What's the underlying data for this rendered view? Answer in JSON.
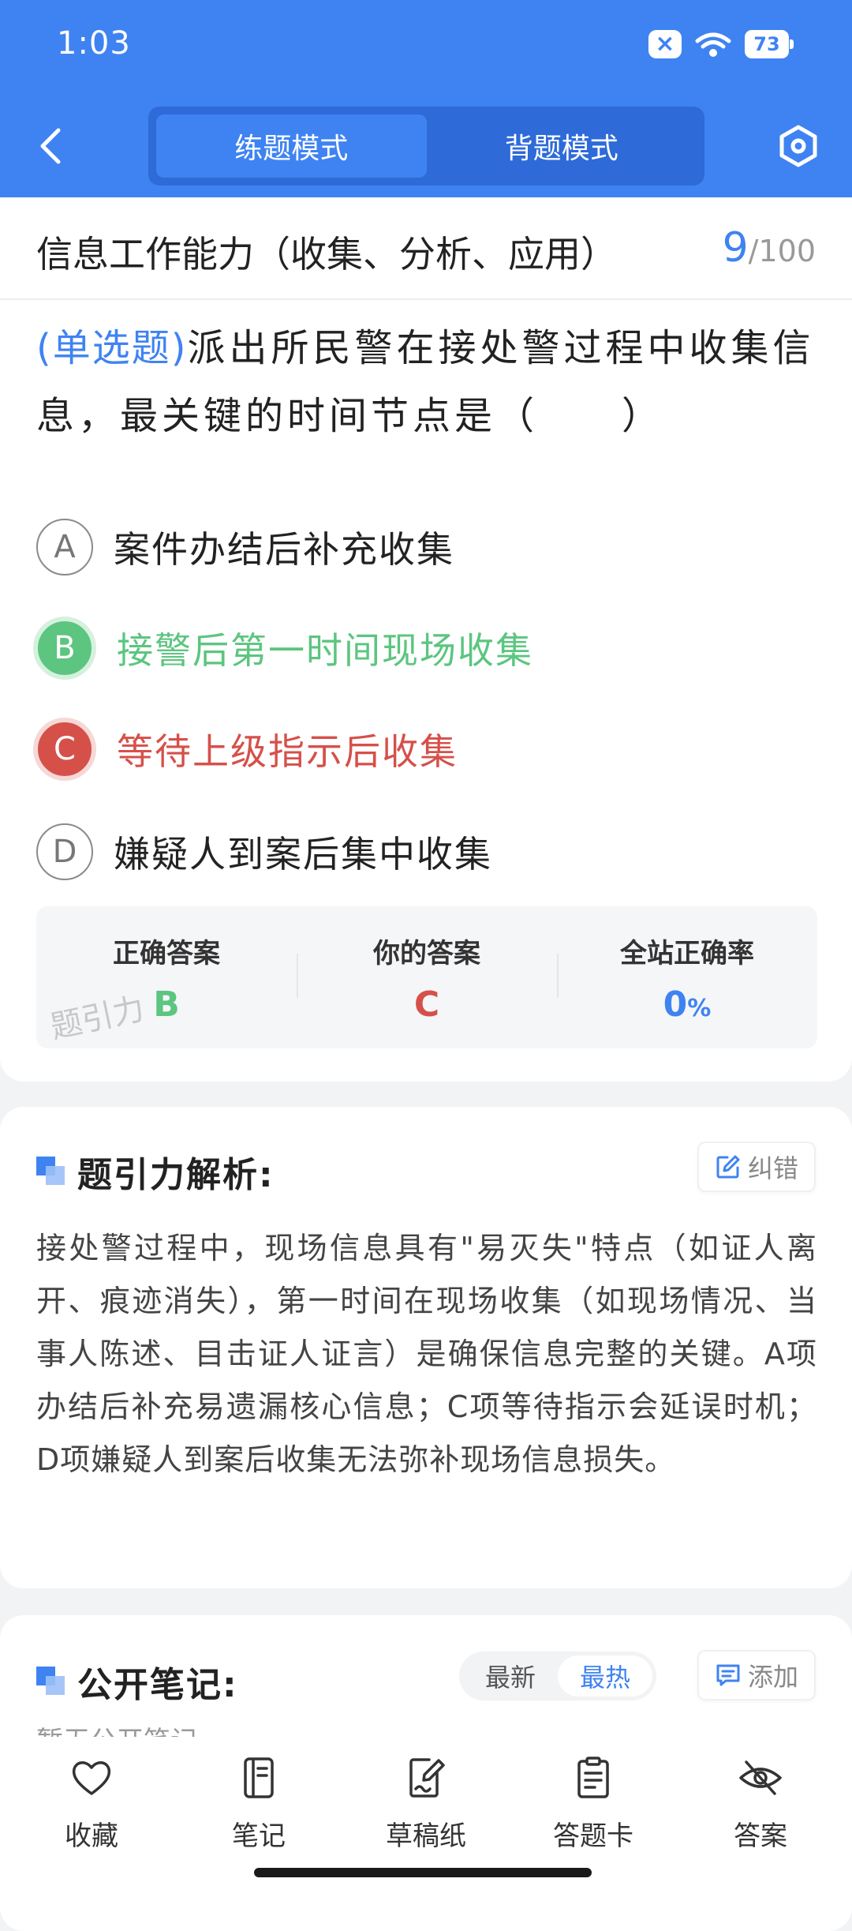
{
  "status_bar": {
    "time": "1:03",
    "battery": "73"
  },
  "header": {
    "tabs": [
      {
        "label": "练题模式",
        "active": true
      },
      {
        "label": "背题模式",
        "active": false
      }
    ]
  },
  "question": {
    "category": "信息工作能力（收集、分析、应用）",
    "current": "9",
    "total": "/100",
    "type_label": "(单选题)",
    "stem": "派出所民警在接处警过程中收集信息，最关键的时间节点是（　　）",
    "options": [
      {
        "letter": "A",
        "text": "案件办结后补充收集",
        "state": "normal"
      },
      {
        "letter": "B",
        "text": "接警后第一时间现场收集",
        "state": "correct"
      },
      {
        "letter": "C",
        "text": "等待上级指示后收集",
        "state": "wrong"
      },
      {
        "letter": "D",
        "text": "嫌疑人到案后集中收集",
        "state": "normal"
      }
    ]
  },
  "answer_summary": {
    "correct_label": "正确答案",
    "correct_value": "B",
    "yours_label": "你的答案",
    "yours_value": "C",
    "rate_label": "全站正确率",
    "rate_value": "0",
    "rate_unit": "%",
    "watermark": "题引力"
  },
  "analysis": {
    "title": "题引力解析:",
    "report_label": "纠错",
    "text": "接处警过程中，现场信息具有\"易灭失\"特点（如证人离开、痕迹消失），第一时间在现场收集（如现场情况、当事人陈述、目击证人证言）是确保信息完整的关键。A项办结后补充易遗漏核心信息；C项等待指示会延误时机；D项嫌疑人到案后收集无法弥补现场信息损失。"
  },
  "notes": {
    "title": "公开笔记:",
    "sort_latest": "最新",
    "sort_hot": "最热",
    "add_label": "添加",
    "empty_text": "暂无公开笔记"
  },
  "bottom_nav": [
    {
      "label": "收藏",
      "icon": "heart-icon"
    },
    {
      "label": "笔记",
      "icon": "notebook-icon"
    },
    {
      "label": "草稿纸",
      "icon": "draft-paper-icon"
    },
    {
      "label": "答题卡",
      "icon": "answer-card-icon"
    },
    {
      "label": "答案",
      "icon": "eye-off-icon"
    }
  ],
  "colors": {
    "primary": "#3f83f2",
    "correct": "#5cc57f",
    "wrong": "#d6504a"
  }
}
